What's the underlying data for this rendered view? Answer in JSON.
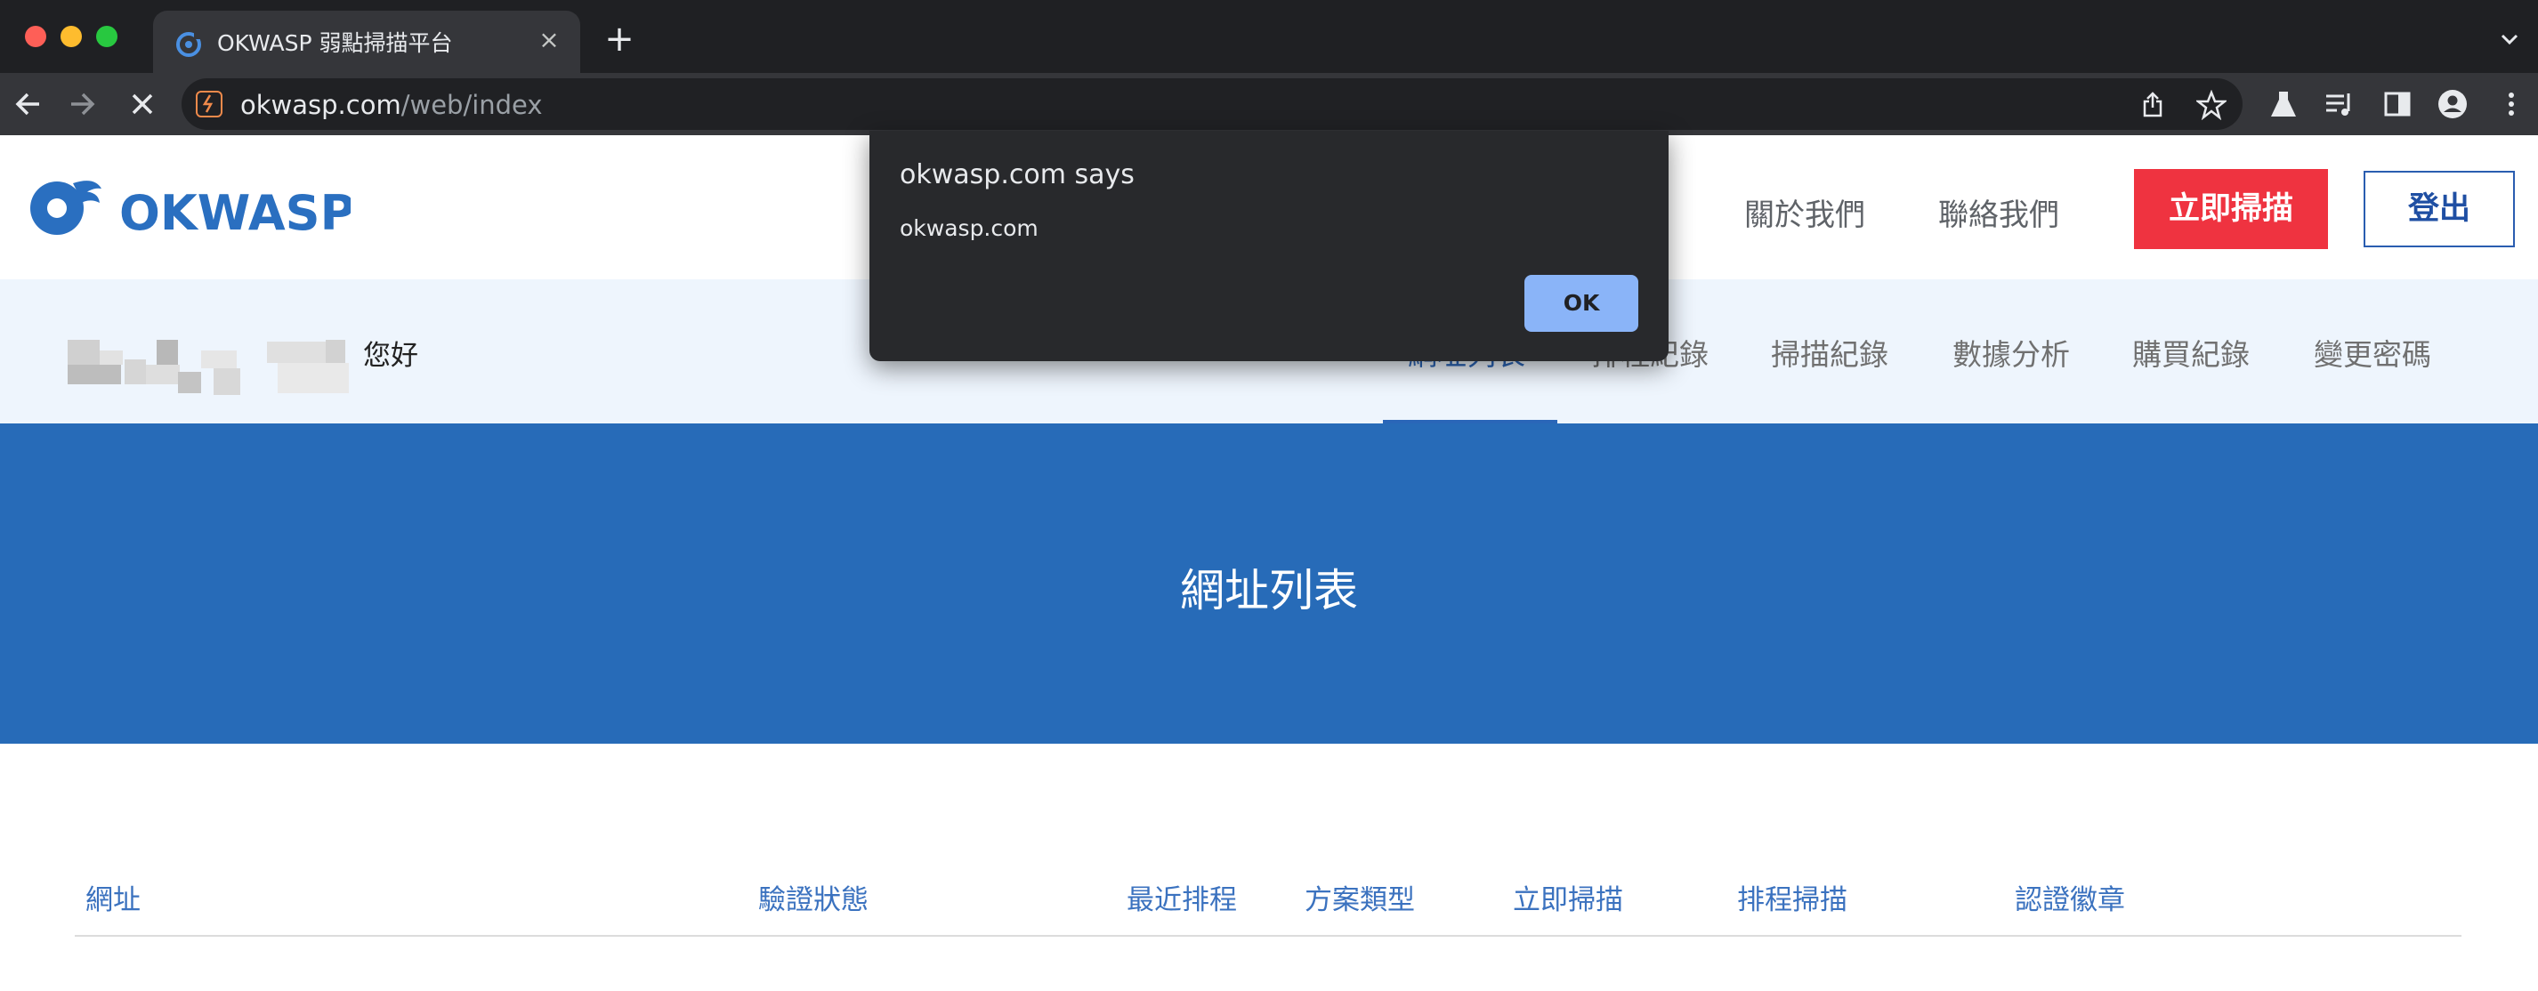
{
  "browser": {
    "tab_title": "OKWASP 弱點掃描平台",
    "url_host": "okwasp.com",
    "url_path": "/web/index"
  },
  "site": {
    "logo_text": "OKWASP",
    "nav": [
      "關於我們",
      "聯絡我們"
    ],
    "scan_button": "立即掃描",
    "logout_button": "登出"
  },
  "user_bar": {
    "greeting": "您好",
    "tabs": [
      "網址列表",
      "排程紀錄",
      "掃描紀錄",
      "數據分析",
      "購買紀錄",
      "變更密碼"
    ],
    "active_tab": "網址列表"
  },
  "hero": {
    "title": "網址列表"
  },
  "table": {
    "headers": [
      "網址",
      "驗證狀態",
      "最近排程",
      "方案類型",
      "立即掃描",
      "排程掃描",
      "認證徽章"
    ]
  },
  "dialog": {
    "title": "okwasp.com says",
    "message": "okwasp.com",
    "ok_label": "OK"
  },
  "colors": {
    "brand_blue": "#276bb8",
    "scan_red": "#ef3340",
    "dialog_button": "#8ab4f8"
  }
}
